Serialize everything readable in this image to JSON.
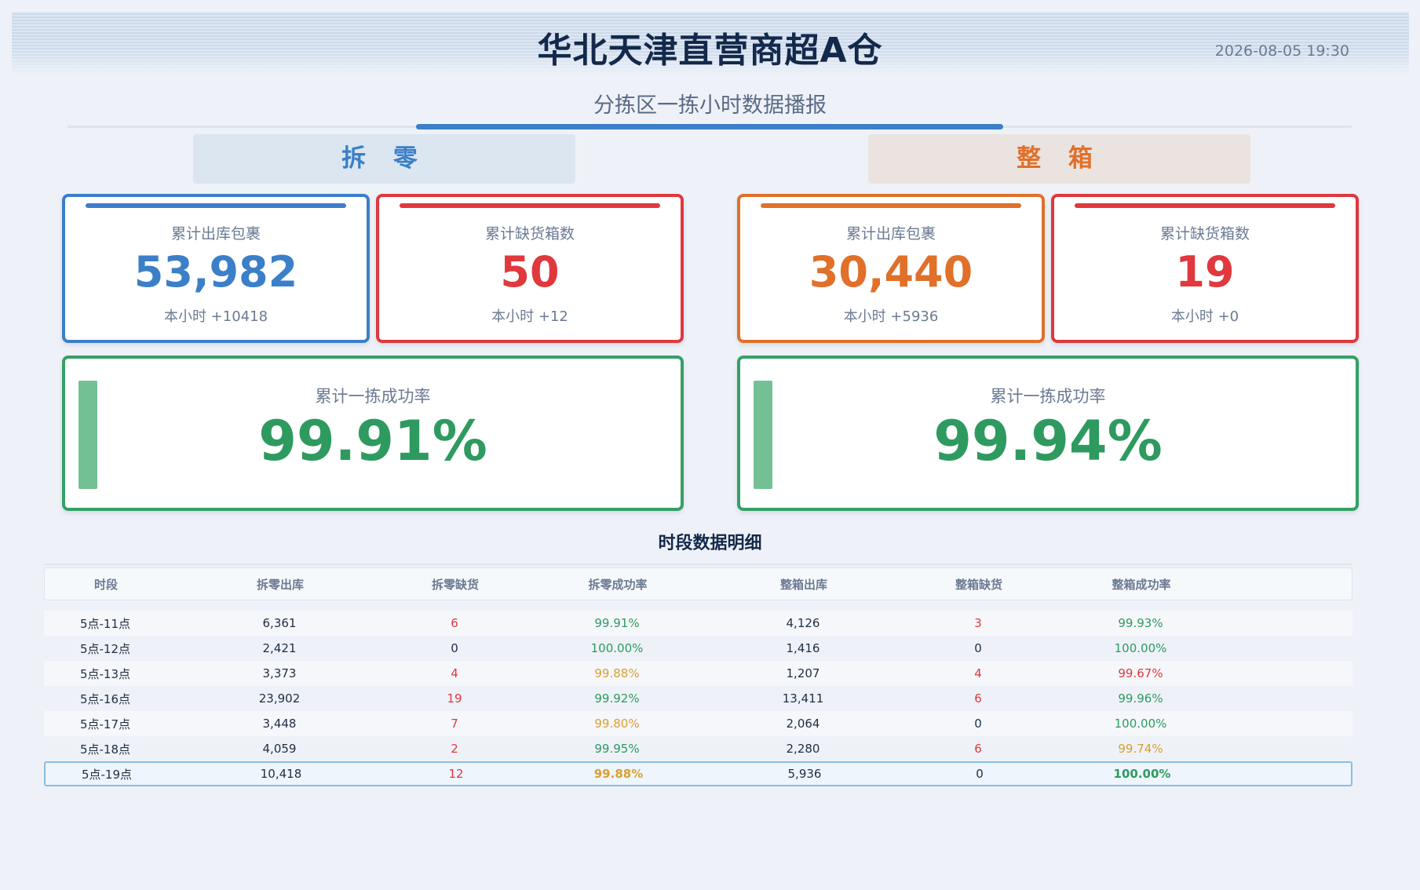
{
  "header": {
    "title": "华北天津直营商超A仓",
    "timestamp": "2026-08-05 19:30",
    "subtitle": "分拣区一拣小时数据播报"
  },
  "sections": {
    "left_label": "拆 零",
    "right_label": "整 箱"
  },
  "cards": {
    "left_outbound": {
      "label": "累计出库包裹",
      "value": "53,982",
      "sub": "本小时 +10418"
    },
    "left_shortage": {
      "label": "累计缺货箱数",
      "value": "50",
      "sub": "本小时 +12"
    },
    "right_outbound": {
      "label": "累计出库包裹",
      "value": "30,440",
      "sub": "本小时 +5936"
    },
    "right_shortage": {
      "label": "累计缺货箱数",
      "value": "19",
      "sub": "本小时 +0"
    }
  },
  "rates": {
    "left": {
      "label": "累计一拣成功率",
      "value": "99.91%"
    },
    "right": {
      "label": "累计一拣成功率",
      "value": "99.94%"
    }
  },
  "detail": {
    "title": "时段数据明细",
    "columns": [
      "时段",
      "拆零出库",
      "拆零缺货",
      "拆零成功率",
      "整箱出库",
      "整箱缺货",
      "整箱成功率"
    ],
    "rows": [
      [
        "5点-11点",
        "6,361",
        "6",
        "99.91%",
        "4,126",
        "3",
        "99.93%"
      ],
      [
        "5点-12点",
        "2,421",
        "0",
        "100.00%",
        "1,416",
        "0",
        "100.00%"
      ],
      [
        "5点-13点",
        "3,373",
        "4",
        "99.88%",
        "1,207",
        "4",
        "99.67%"
      ],
      [
        "5点-16点",
        "23,902",
        "19",
        "99.92%",
        "13,411",
        "6",
        "99.96%"
      ],
      [
        "5点-17点",
        "3,448",
        "7",
        "99.80%",
        "2,064",
        "0",
        "100.00%"
      ],
      [
        "5点-18点",
        "4,059",
        "2",
        "99.95%",
        "2,280",
        "6",
        "99.74%"
      ],
      [
        "5点-19点",
        "10,418",
        "12",
        "99.88%",
        "5,936",
        "0",
        "100.00%"
      ]
    ]
  },
  "colors": {
    "blue": "#3b7fc8",
    "red": "#e0383d",
    "orange": "#e0702a",
    "green": "#2e9a5f",
    "amber": "#d9a030"
  }
}
